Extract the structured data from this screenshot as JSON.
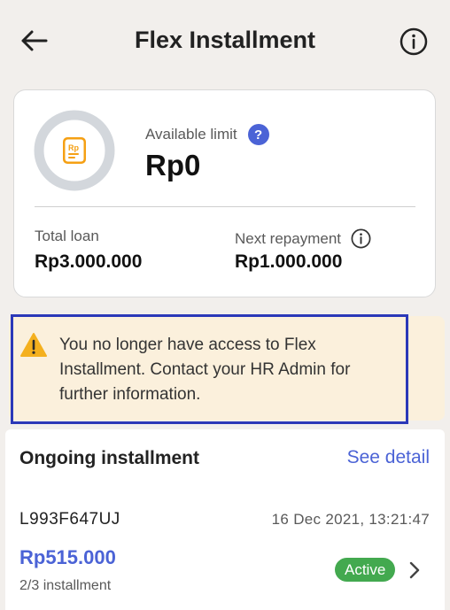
{
  "header": {
    "title": "Flex Installment",
    "back_icon": "arrow-left-icon",
    "info_icon": "info-circle-icon"
  },
  "limit_card": {
    "available_label": "Available limit",
    "help_mark": "?",
    "available_value": "Rp0",
    "total_loan_label": "Total loan",
    "total_loan_value": "Rp3.000.000",
    "next_repayment_label": "Next repayment",
    "next_repayment_value": "Rp1.000.000",
    "logo_icon": "rp-document-icon"
  },
  "warning": {
    "icon": "warning-triangle-icon",
    "text": "You no longer have access to Flex Installment. Contact your HR Admin for further information."
  },
  "ongoing": {
    "title": "Ongoing installment",
    "see_detail": "See detail",
    "items": [
      {
        "id": "L993F647UJ",
        "date": "16 Dec 2021, 13:21:47",
        "amount": "Rp515.000",
        "progress": "2/3 installment",
        "status": "Active"
      }
    ]
  },
  "colors": {
    "background": "#f2efec",
    "accent": "#4b63d6",
    "warning_bg": "#fbf0dc",
    "warning_icon": "#f4b01e",
    "status_active": "#43a94f",
    "highlight_outline": "#2b38b8",
    "logo_orange": "#f5a014"
  }
}
